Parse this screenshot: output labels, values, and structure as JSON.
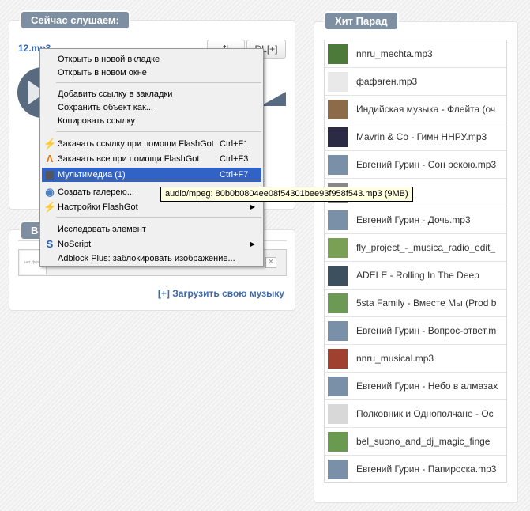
{
  "now_playing": {
    "title": "Сейчас слушаем:",
    "track": "12.mp3",
    "share_icon": "share-icon",
    "dl_label": "DL[+]"
  },
  "upload": {
    "title_visible": "Ва",
    "thumb_text": "нет фото",
    "close_glyph": "✕",
    "upload_link": "[+] Загрузить свою музыку"
  },
  "hit_parade": {
    "title": "Хит Парад",
    "items": [
      {
        "name": "nnru_mechta.mp3",
        "thumb": "#4c7a3a"
      },
      {
        "name": "фафаген.mp3",
        "thumb": "#e9e9e9"
      },
      {
        "name": "Индийская музыка - Флейта (оч",
        "thumb": "#8c6a4a"
      },
      {
        "name": "Mavrin & Co - Гимн ННРУ.mp3",
        "thumb": "#2b2b46"
      },
      {
        "name": "Евгений Гурин - Сон рекою.mp3",
        "thumb": "#7a8fa8"
      },
      {
        "name": "G.mp3",
        "thumb": "#888888"
      },
      {
        "name": "Евгений Гурин - Дочь.mp3",
        "thumb": "#7a8fa8"
      },
      {
        "name": "fly_project_-_musica_radio_edit_",
        "thumb": "#7aa055"
      },
      {
        "name": "ADELE - Rolling In The Deep",
        "thumb": "#3d5060"
      },
      {
        "name": "5sta Family - Вместе Мы (Prod b",
        "thumb": "#6c9a55"
      },
      {
        "name": "Евгений Гурин - Вопрос-ответ.m",
        "thumb": "#7a8fa8"
      },
      {
        "name": "nnru_musical.mp3",
        "thumb": "#a04030"
      },
      {
        "name": "Евгений Гурин - Небо в алмазах",
        "thumb": "#7a8fa8"
      },
      {
        "name": "Полковник и Однополчане - Ос",
        "thumb": "#d8d8d8"
      },
      {
        "name": "bel_suono_and_dj_magic_finge",
        "thumb": "#6a9a50"
      },
      {
        "name": "Евгений Гурин - Папироска.mp3",
        "thumb": "#7a8fa8"
      }
    ]
  },
  "context_menu": {
    "items": [
      {
        "label": "Открыть в новой вкладке"
      },
      {
        "label": "Открыть в новом окне"
      },
      {
        "label": "Добавить ссылку в закладки"
      },
      {
        "label": "Сохранить объект как..."
      },
      {
        "label": "Копировать ссылку"
      },
      {
        "label": "Закачать ссылку при помощи FlashGot",
        "shortcut": "Ctrl+F1",
        "icon": "flashgot-icon"
      },
      {
        "label": "Закачать все при помощи FlashGot",
        "shortcut": "Ctrl+F3",
        "icon": "flashgot-all-icon"
      },
      {
        "label": "Мультимедиа (1)",
        "shortcut": "Ctrl+F7",
        "icon": "multimedia-icon",
        "selected": true
      },
      {
        "label": "Создать галерею...",
        "icon": "gallery-icon"
      },
      {
        "label": "Настройки FlashGot",
        "icon": "flashgot-settings-icon",
        "submenu": true
      },
      {
        "label": "Исследовать элемент"
      },
      {
        "label": "NoScript",
        "icon": "noscript-icon",
        "submenu": true
      },
      {
        "label": "Adblock Plus: заблокировать изображение..."
      }
    ]
  },
  "tooltip": "audio/mpeg: 80b0b0804ee08f54301bee93f958f543.mp3 (9MB)"
}
